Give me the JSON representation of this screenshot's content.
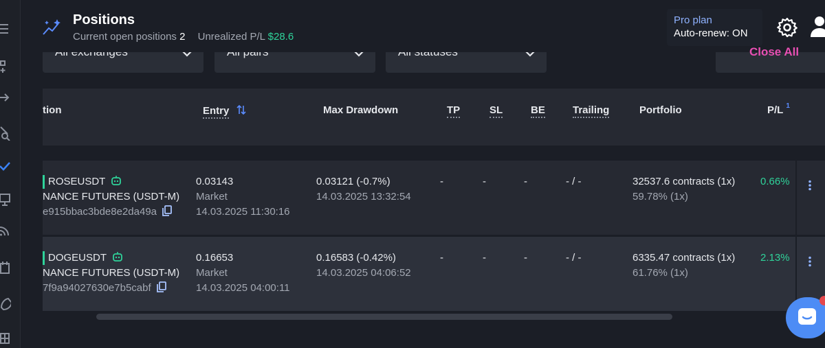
{
  "header": {
    "title": "Positions",
    "open_positions_label": "Current open positions",
    "open_positions_count": "2",
    "unrealized_label": "Unrealized P/L",
    "unrealized_value": "$28.6"
  },
  "plan": {
    "name": "Pro plan",
    "renew": "Auto-renew: ON"
  },
  "filters": {
    "exchanges": "All exchanges",
    "pairs": "All pairs",
    "statuses": "All statuses",
    "close_all": "Close All"
  },
  "columns": {
    "position": "tion",
    "entry": "Entry",
    "max_drawdown": "Max Drawdown",
    "tp": "TP",
    "sl": "SL",
    "be": "BE",
    "trailing": "Trailing",
    "portfolio": "Portfolio",
    "pl": "P/L",
    "pl_sup": "1"
  },
  "rows": [
    {
      "symbol": "ROSEUSDT",
      "exchange": "NANCE FUTURES (USDT-M)",
      "id": "e915bbac3bde8e2da49a",
      "entry_price": "0.03143",
      "entry_type": "Market",
      "entry_time": "14.03.2025 11:30:16",
      "drawdown": "0.03121 (-0.7%)",
      "drawdown_time": "14.03.2025 13:32:54",
      "tp": "-",
      "sl": "-",
      "be": "-",
      "trailing": "- / -",
      "portfolio_contracts": "32537.6 contracts (1x)",
      "portfolio_pct": "59.78% (1x)",
      "pl": "0.66%"
    },
    {
      "symbol": "DOGEUSDT",
      "exchange": "NANCE FUTURES (USDT-M)",
      "id": "7f9a94027630e7b5cabf",
      "entry_price": "0.16653",
      "entry_type": "Market",
      "entry_time": "14.03.2025 04:00:11",
      "drawdown": "0.16583 (-0.42%)",
      "drawdown_time": "14.03.2025 04:06:52",
      "tp": "-",
      "sl": "-",
      "be": "-",
      "trailing": "- / -",
      "portfolio_contracts": "6335.47 contracts (1x)",
      "portfolio_pct": "61.76% (1x)",
      "pl": "2.13%"
    }
  ],
  "colors": {
    "background": "#1b1e26",
    "accent_blue": "#5b8cff",
    "positive_green": "#2fd39a",
    "close_all_pink": "#e84fb3",
    "chat_blue": "#4d8cf5"
  },
  "icons": {
    "sidebar": [
      "menu-icon",
      "add-widget-icon",
      "arrow-icon",
      "pen-search-icon",
      "check-icon",
      "monitor-icon",
      "signal-icon",
      "calendar-icon",
      "rocket-icon",
      "grid-icon"
    ],
    "header": [
      "sparkle-chart-icon",
      "gear-icon",
      "user-icon"
    ],
    "row": [
      "bot-icon",
      "copy-icon",
      "kebab-menu-icon"
    ],
    "chat": "chat-icon"
  }
}
